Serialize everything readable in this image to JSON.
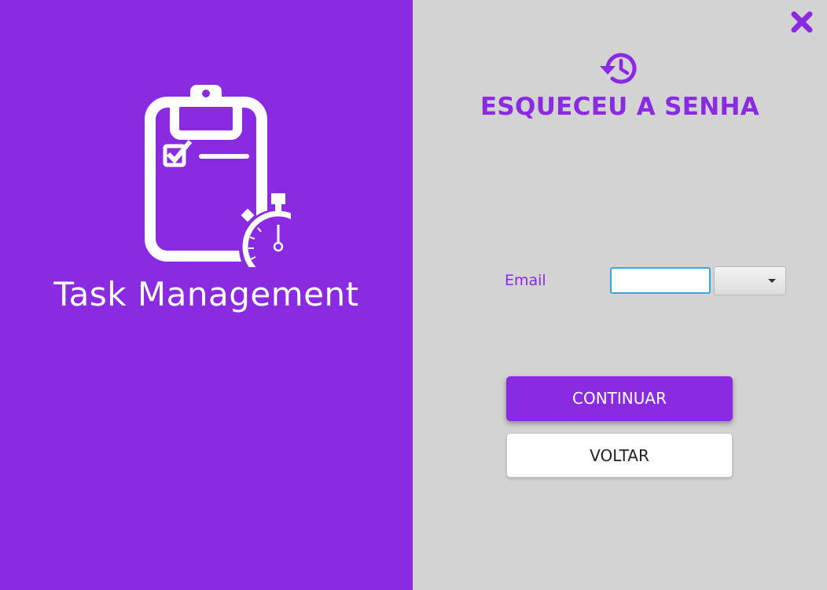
{
  "left_panel": {
    "app_title": "Task Management",
    "logo_icon": "clipboard-stopwatch-icon",
    "background_color": "#8a2be2"
  },
  "right_panel": {
    "close_icon": "close-icon",
    "history_icon": "history-icon",
    "title": "ESQUECEU A SENHA",
    "email_label": "Email",
    "email_value": "",
    "domain_select_value": "",
    "continue_label": "CONTINUAR",
    "back_label": "VOLTAR",
    "background_color": "#d3d3d3",
    "accent_color": "#8a2be2"
  }
}
